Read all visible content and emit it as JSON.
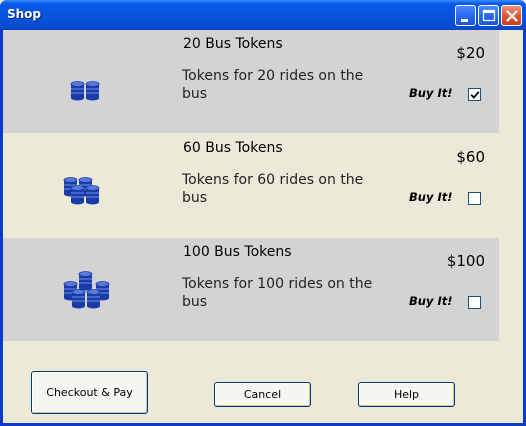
{
  "window": {
    "title": "Shop"
  },
  "products": [
    {
      "name": "20 Bus Tokens",
      "description": "Tokens for 20 rides on the bus",
      "price": "$20",
      "buy_label": "Buy It!",
      "checked": true,
      "icon": "token-stack-icon"
    },
    {
      "name": "60 Bus Tokens",
      "description": "Tokens for 60 rides on the bus",
      "price": "$60",
      "buy_label": "Buy It!",
      "checked": false,
      "icon": "token-stack-icon"
    },
    {
      "name": "100 Bus Tokens",
      "description": "Tokens for 100 rides on the bus",
      "price": "$100",
      "buy_label": "Buy It!",
      "checked": false,
      "icon": "token-stack-icon"
    }
  ],
  "buttons": {
    "checkout": "Checkout & Pay",
    "cancel": "Cancel",
    "help": "Help"
  },
  "colors": {
    "title_bar": "#0654E0",
    "row_shade": "#D3D3D3",
    "background": "#ECE9D8",
    "token_blue": "#1A3CA8"
  }
}
